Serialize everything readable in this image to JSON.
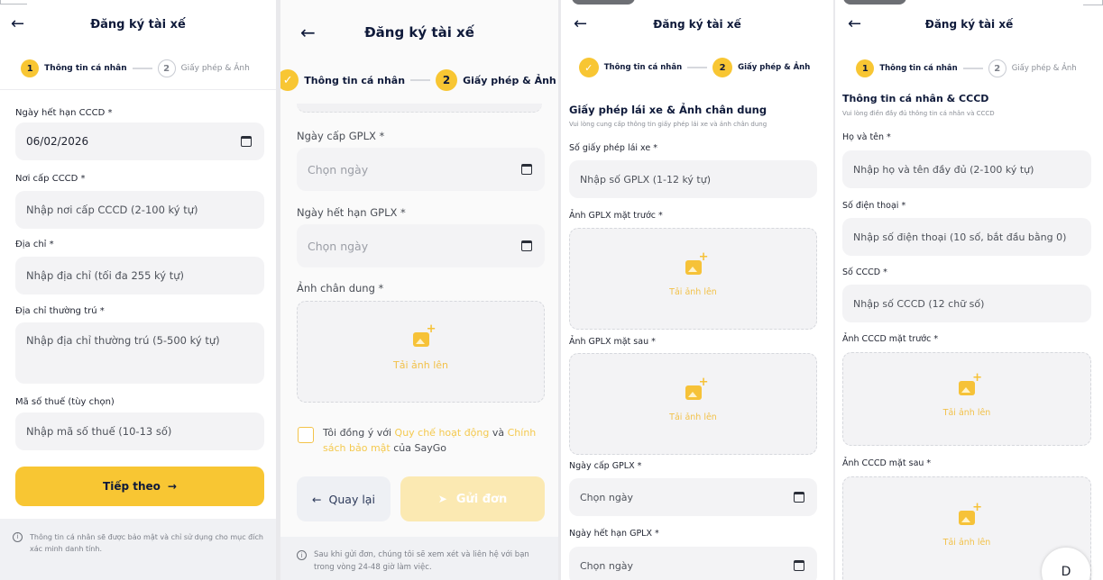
{
  "header": {
    "back_icon": "←",
    "title": "Đăng ký tài xế"
  },
  "steps": {
    "step1_number": "1",
    "step1_label": "Thông tin cá nhân",
    "step2_number": "2",
    "step2_label": "Giấy phép & Ảnh",
    "done_mark": "✓"
  },
  "colors": {
    "accent": "#f8c633",
    "navy": "#0f1a3a",
    "field_bg": "#f3f3f5"
  },
  "icons": {
    "back": "arrow-left-icon",
    "calendar": "calendar-icon",
    "upload": "image-add-icon",
    "info": "info-icon",
    "send": "send-icon"
  },
  "screen1": {
    "cccd_expiry_label": "Ngày hết hạn CCCD *",
    "cccd_expiry_value": "06/02/2026",
    "cccd_place_label": "Nơi cấp CCCD *",
    "cccd_place_placeholder": "Nhập nơi cấp CCCD (2-100 ký tự)",
    "address_label": "Địa chỉ *",
    "address_placeholder": "Nhập địa chỉ (tối đa 255 ký tự)",
    "permanent_label": "Địa chỉ thường trú *",
    "permanent_placeholder": "Nhập địa chỉ thường trú (5-500 ký tự)",
    "tax_label": "Mã số thuế (tùy chọn)",
    "tax_placeholder": "Nhập mã số thuế (10-13 số)",
    "next_button": "Tiếp theo",
    "next_arrow": "→",
    "info_icon": "i",
    "footer_note": "Thông tin cá nhân sẽ được bảo mật và chỉ sử dụng cho mục đích xác minh danh tính."
  },
  "screen2": {
    "issue_label": "Ngày cấp GPLX *",
    "issue_placeholder": "Chọn ngày",
    "expiry_label": "Ngày hết hạn GPLX *",
    "expiry_placeholder": "Chọn ngày",
    "portrait_label": "Ảnh chân dung *",
    "upload_text": "Tải ảnh lên",
    "agree_prefix": "Tôi đồng ý với ",
    "agree_link1": "Quy chế hoạt động",
    "agree_and": " và ",
    "agree_link2": "Chính sách bảo mật",
    "agree_suffix": " của SayGo",
    "back_button": "Quay lại",
    "back_arrow": "←",
    "submit_button": "Gửi đơn",
    "submit_icon": "➤",
    "info_icon": "i",
    "footer_note": "Sau khi gửi đơn, chúng tôi sẽ xem xét và liên hệ với bạn trong vòng 24-48 giờ làm việc."
  },
  "screen3": {
    "section_title": "Giấy phép lái xe & Ảnh chân dung",
    "section_subtitle": "Vui lòng cung cấp thông tin giấy phép lái xe và ảnh chân dung",
    "license_no_label": "Số giấy phép lái xe *",
    "license_no_placeholder": "Nhập số GPLX (1-12 ký tự)",
    "front_label": "Ảnh GPLX mặt trước *",
    "back_label": "Ảnh GPLX mặt sau *",
    "upload_text": "Tải ảnh lên",
    "issue_label": "Ngày cấp GPLX *",
    "issue_placeholder": "Chọn ngày",
    "expiry_label": "Ngày hết hạn GPLX *",
    "expiry_placeholder": "Chọn ngày"
  },
  "screen4": {
    "section_title": "Thông tin cá nhân & CCCD",
    "section_subtitle": "Vui lòng điền đầy đủ thông tin cá nhân và CCCD",
    "name_label": "Họ và tên *",
    "name_placeholder": "Nhập họ và tên đầy đủ (2-100 ký tự)",
    "phone_label": "Số điện thoại *",
    "phone_placeholder": "Nhập số điện thoại (10 số, bắt đầu bằng 0)",
    "cccd_label": "Số CCCD *",
    "cccd_placeholder": "Nhập số CCCD (12 chữ số)",
    "front_label": "Ảnh CCCD mặt trước *",
    "back_label": "Ảnh CCCD mặt sau *",
    "upload_text": "Tải ảnh lên",
    "fab_glyph": "D"
  }
}
